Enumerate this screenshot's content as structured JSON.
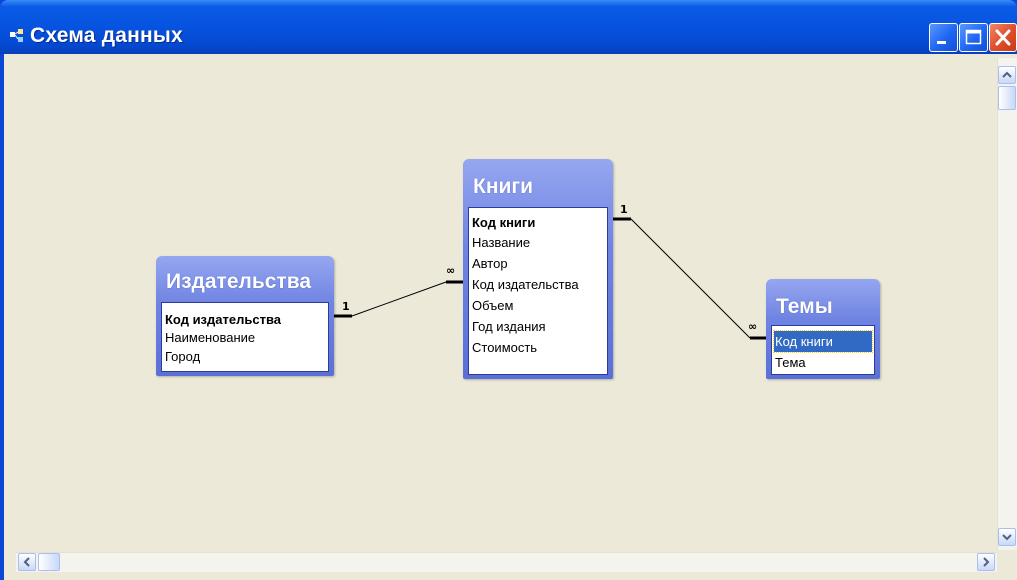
{
  "window": {
    "title": "Схема данных",
    "minimize_glyph": "_",
    "maximize_glyph": "□",
    "close_glyph": "✕"
  },
  "tables": [
    {
      "name": "Издательства",
      "fields": [
        {
          "label": "Код издательства",
          "key": true
        },
        {
          "label": "Наименование",
          "key": false
        },
        {
          "label": "Город",
          "key": false
        }
      ]
    },
    {
      "name": "Книги",
      "fields": [
        {
          "label": "Код книги",
          "key": true
        },
        {
          "label": "Название",
          "key": false
        },
        {
          "label": "Автор",
          "key": false
        },
        {
          "label": "Код издательства",
          "key": false
        },
        {
          "label": "Объем",
          "key": false
        },
        {
          "label": "Год издания",
          "key": false
        },
        {
          "label": "Стоимость",
          "key": false
        }
      ]
    },
    {
      "name": "Темы",
      "fields": [
        {
          "label": "Код книги",
          "key": false,
          "selected": true
        },
        {
          "label": "Тема",
          "key": false
        }
      ]
    }
  ],
  "relationships": [
    {
      "from_table": "Издательства",
      "from_field": "Код издательства",
      "from_card": "1",
      "to_table": "Книги",
      "to_field": "Код издательства",
      "to_card": "∞"
    },
    {
      "from_table": "Книги",
      "from_field": "Код книги",
      "from_card": "1",
      "to_table": "Темы",
      "to_field": "Код книги",
      "to_card": "∞"
    }
  ],
  "colors": {
    "titlebar": "#0653df",
    "workspace": "#ece9d8",
    "table_header": "#6f84e2",
    "selection": "#316ac5"
  }
}
